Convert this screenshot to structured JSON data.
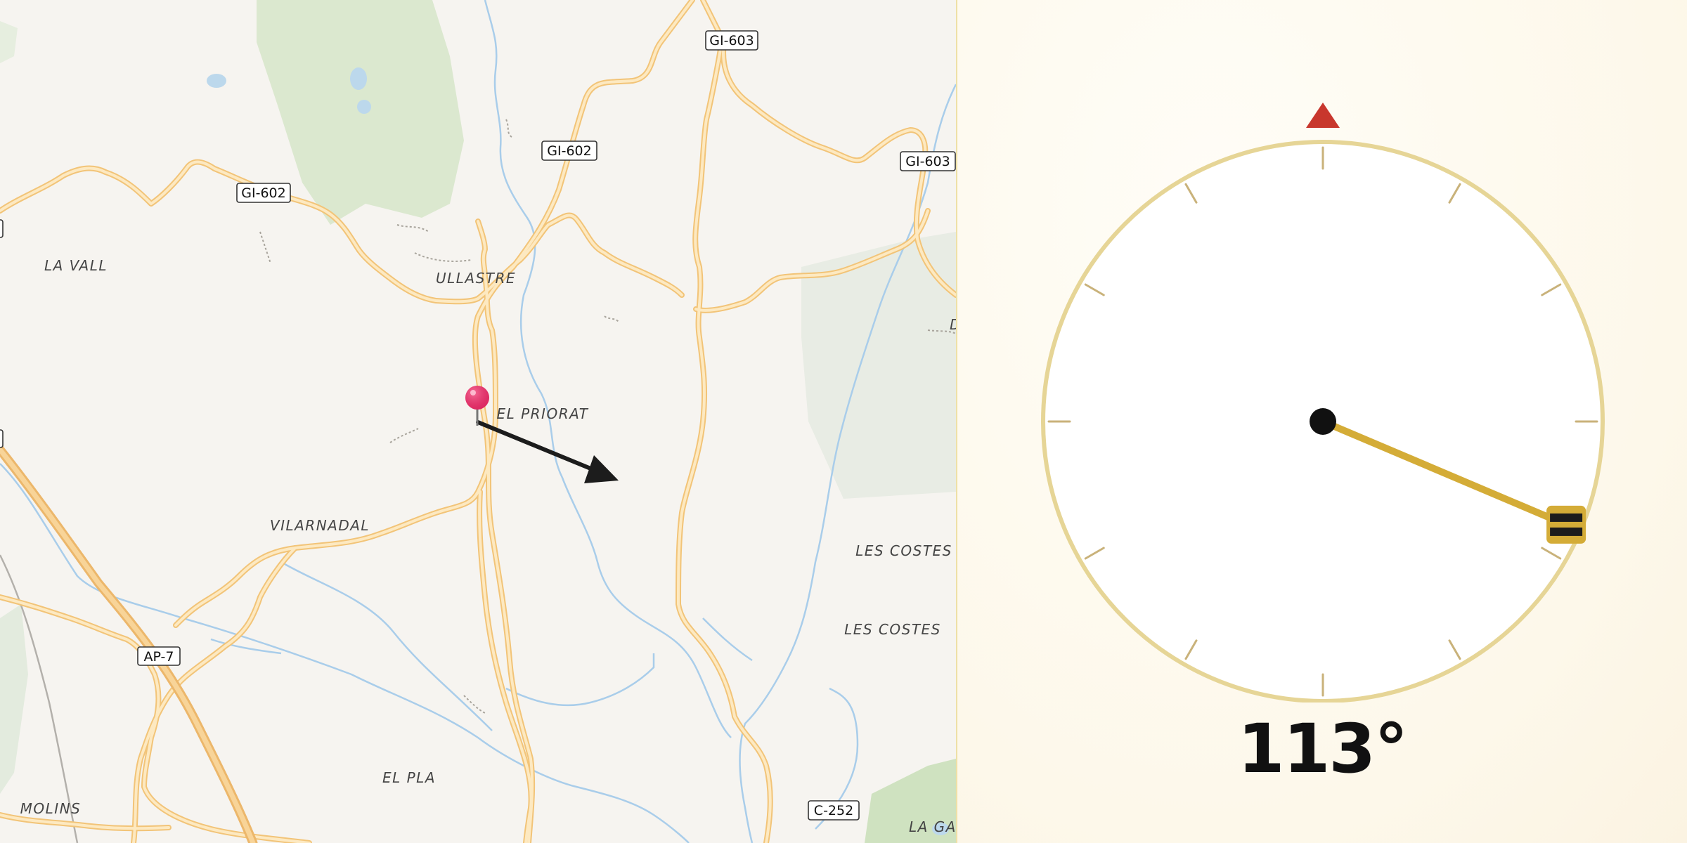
{
  "map": {
    "road_shields": [
      "GI-603",
      "GI-602",
      "GI-602",
      "GI-603",
      "AP-7",
      "C-252"
    ],
    "place_labels": [
      "LA VALL",
      "ULLASTRE",
      "EL PRIORAT",
      "VILARNADAL",
      "LES COSTES",
      "LES COSTES",
      "EL PLA",
      "MOLINS",
      "LA GAR",
      "D"
    ],
    "pin_color": "#e8336b",
    "arrow_color": "#1c1c1c"
  },
  "compass": {
    "north_marker_color": "#c8372d",
    "needle_color": "#d4ac37",
    "heading_degrees": 113,
    "heading_label": "113°"
  }
}
